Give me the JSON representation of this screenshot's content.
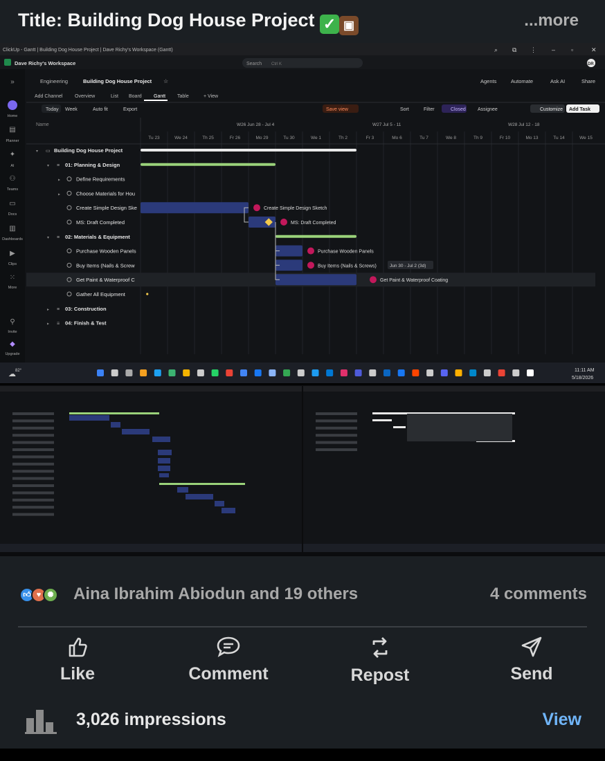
{
  "post": {
    "title": "Title: Building Dog House Project",
    "title_icons": [
      "check-mark-icon",
      "briefcase-icon"
    ],
    "more_label": "...more"
  },
  "window": {
    "tab_title": "ClickUp - Gantt | Building Dog House Project | Dave Richy's Workspace (Gantt)",
    "workspace": "Dave Richy's Workspace",
    "search_placeholder": "Search",
    "search_shortcut": "Ctrl K",
    "avatar_initials": "DR"
  },
  "breadcrumb": {
    "space": "Engineering",
    "project": "Building Dog House Project"
  },
  "header_actions": {
    "agents": "Agents",
    "automate": "Automate",
    "ask_ai": "Ask AI",
    "share": "Share"
  },
  "view_tabs": [
    "Add Channel",
    "Overview",
    "List",
    "Board",
    "Gantt",
    "Table",
    "+ View"
  ],
  "active_tab": "Gantt",
  "toolbar": {
    "today": "Today",
    "week": "Week",
    "autofit": "Auto fit",
    "export": "Export",
    "save_view": "Save view",
    "sort": "Sort",
    "filter": "Filter",
    "closed": "Closed",
    "assignee": "Assignee",
    "customize": "Customize",
    "add_task": "Add Task"
  },
  "left_nav": [
    "Home",
    "Planner",
    "AI",
    "Teams",
    "Docs",
    "Dashboards",
    "Clips",
    "More",
    "Invite",
    "Upgrade"
  ],
  "gantt": {
    "name_header": "Name",
    "week_labels": [
      "W26  Jun 28 - Jul 4",
      "W27  Jul 5 - 11",
      "W28  Jul 12 - 18"
    ],
    "days": [
      "Tu 23",
      "We 24",
      "Th 25",
      "Fr 26",
      "Mo 29",
      "Tu 30",
      "We 1",
      "Th 2",
      "Fr 3",
      "Mo 6",
      "Tu 7",
      "We 8",
      "Th 9",
      "Fr 10",
      "Mo 13",
      "Tu 14",
      "We 15"
    ],
    "tasks": [
      {
        "name": "Building Dog House Project",
        "kind": "project"
      },
      {
        "name": "01: Planning & Design",
        "kind": "group"
      },
      {
        "name": "Define Requirements",
        "kind": "task"
      },
      {
        "name": "Choose Materials for Hou",
        "kind": "task"
      },
      {
        "name": "Create Simple Design Ske",
        "kind": "task",
        "bar_label": "Create Simple Design Sketch"
      },
      {
        "name": "MS: Draft Completed",
        "kind": "milestone",
        "bar_label": "MS: Draft Completed"
      },
      {
        "name": "02: Materials & Equipment",
        "kind": "group"
      },
      {
        "name": "Purchase Wooden Panels",
        "kind": "task",
        "bar_label": "Purchase Wooden Panels"
      },
      {
        "name": "Buy Items (Nails & Screw",
        "kind": "task",
        "bar_label": "Buy Items (Nails & Screws)"
      },
      {
        "name": "Get Paint & Waterproof C",
        "kind": "task",
        "bar_label": "Get Paint & Waterproof Coating"
      },
      {
        "name": "Gather All Equipment",
        "kind": "task"
      },
      {
        "name": "03: Construction",
        "kind": "group"
      },
      {
        "name": "04: Finish & Test",
        "kind": "group"
      }
    ],
    "tooltip": "Jun 30 - Jul 2 (3d)"
  },
  "taskbar": {
    "temp": "82°",
    "time": "11:11 AM",
    "date": "5/18/2026"
  },
  "social": {
    "reactions": [
      "like-icon",
      "love-icon",
      "celebrate-icon"
    ],
    "reactors": "Aina Ibrahim Abiodun and 19 others",
    "comments": "4 comments",
    "actions": {
      "like": "Like",
      "comment": "Comment",
      "repost": "Repost",
      "send": "Send"
    },
    "impressions": "3,026 impressions",
    "view": "View"
  },
  "colors": {
    "accent": "#7b68ee",
    "bar": "#2b3a7a",
    "progress": "#9ad27a",
    "link": "#70b5f9",
    "pink": "#c2185b"
  }
}
